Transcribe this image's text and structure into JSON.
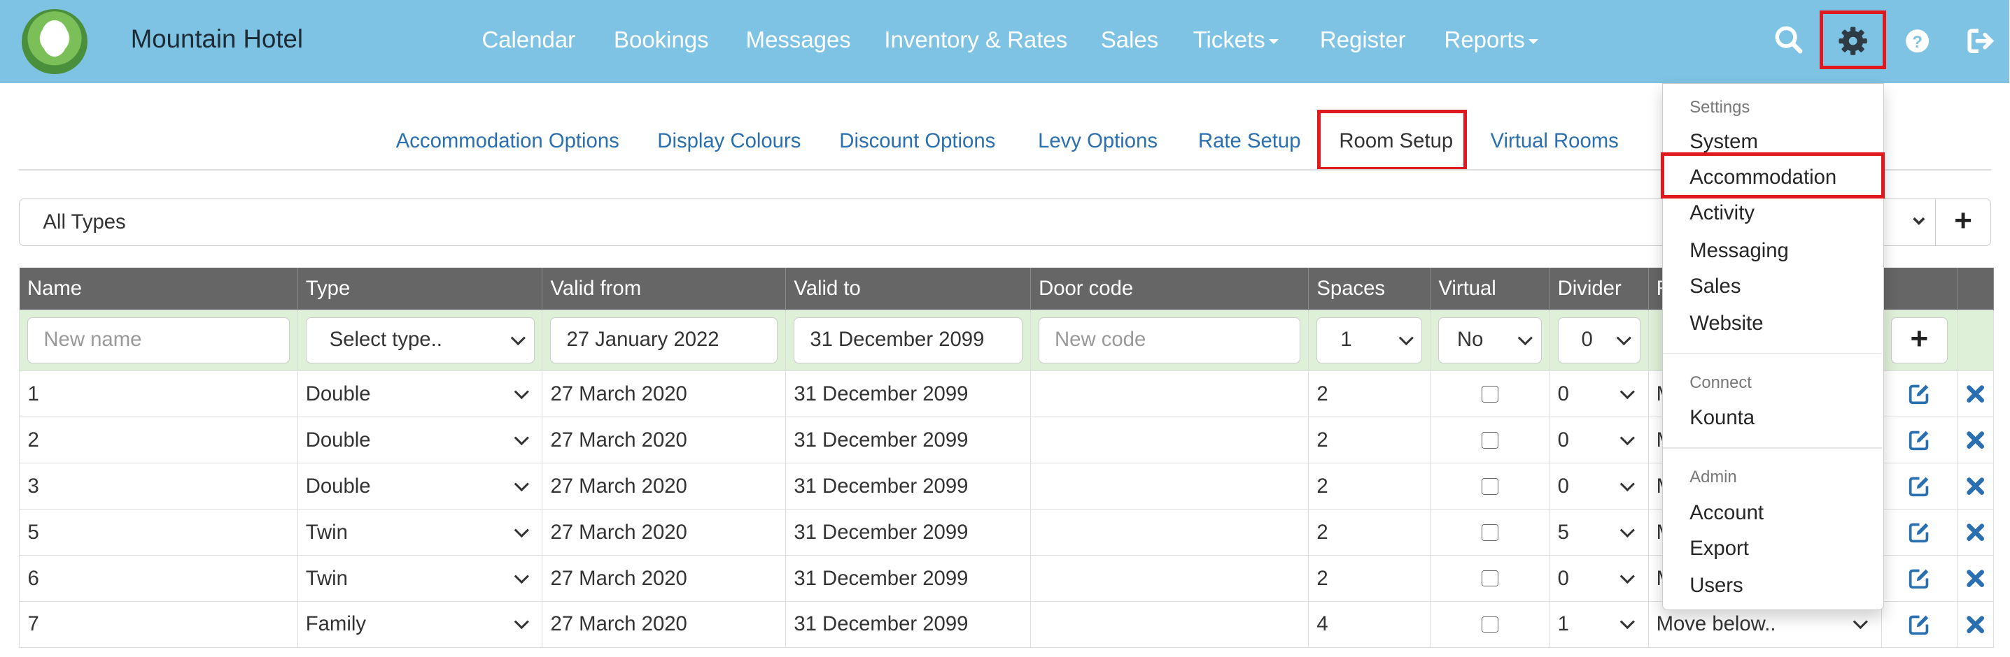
{
  "navbar": {
    "brand": "Mountain Hotel",
    "links": [
      "Calendar",
      "Bookings",
      "Messages",
      "Inventory & Rates",
      "Sales",
      "Tickets",
      "Register",
      "Reports"
    ],
    "icons": [
      "search-icon",
      "gear-icon",
      "help-icon",
      "logout-icon"
    ]
  },
  "subtabs": [
    "Accommodation Options",
    "Display Colours",
    "Discount Options",
    "Levy Options",
    "Rate Setup",
    "Room Setup",
    "Virtual Rooms"
  ],
  "filter": {
    "selected": "All Types"
  },
  "table": {
    "headers": [
      "Name",
      "Type",
      "Valid from",
      "Valid to",
      "Door code",
      "Spaces",
      "Virtual",
      "Divider",
      "R"
    ],
    "new_row": {
      "name_placeholder": "New name",
      "type_placeholder": "Select type..",
      "valid_from": "27 January 2022",
      "valid_to": "31 December 2099",
      "code_placeholder": "New code",
      "spaces": "1",
      "virtual": "No",
      "divider": "0"
    },
    "rows": [
      {
        "name": "1",
        "type": "Double",
        "from": "27 March 2020",
        "to": "31 December 2099",
        "spaces": "2",
        "divider": "0",
        "r": "M"
      },
      {
        "name": "2",
        "type": "Double",
        "from": "27 March 2020",
        "to": "31 December 2099",
        "spaces": "2",
        "divider": "0",
        "r": "M"
      },
      {
        "name": "3",
        "type": "Double",
        "from": "27 March 2020",
        "to": "31 December 2099",
        "spaces": "2",
        "divider": "0",
        "r": "M"
      },
      {
        "name": "5",
        "type": "Twin",
        "from": "27 March 2020",
        "to": "31 December 2099",
        "spaces": "2",
        "divider": "5",
        "r": "M"
      },
      {
        "name": "6",
        "type": "Twin",
        "from": "27 March 2020",
        "to": "31 December 2099",
        "spaces": "2",
        "divider": "0",
        "r": "M"
      },
      {
        "name": "7",
        "type": "Family",
        "from": "27 March 2020",
        "to": "31 December 2099",
        "spaces": "4",
        "divider": "1",
        "r": "Move below.."
      }
    ]
  },
  "menu": {
    "settings_header": "Settings",
    "settings": [
      "System",
      "Accommodation",
      "Activity",
      "Messaging",
      "Sales",
      "Website"
    ],
    "connect_header": "Connect",
    "connect": [
      "Kounta"
    ],
    "admin_header": "Admin",
    "admin": [
      "Account",
      "Export",
      "Users"
    ]
  },
  "colors": {
    "navbar": "#7ec3e3",
    "table_header": "#666666",
    "new_row": "#dff0d8",
    "link": "#2a6fb0",
    "highlight": "#e0191f"
  }
}
